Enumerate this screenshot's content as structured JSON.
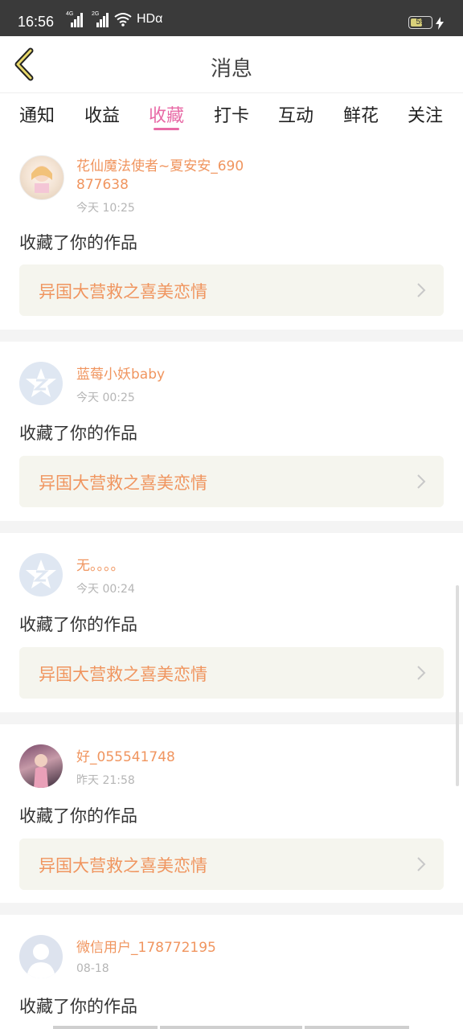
{
  "status": {
    "time": "16:56",
    "sig1": "4G",
    "sig2": "2G",
    "hd": "HDα",
    "battery": "59",
    "battery_level": 0.59
  },
  "header": {
    "title": "消息"
  },
  "tabs": [
    {
      "label": "通知"
    },
    {
      "label": "收益"
    },
    {
      "label": "收藏"
    },
    {
      "label": "打卡"
    },
    {
      "label": "互动"
    },
    {
      "label": "鲜花"
    },
    {
      "label": "关注"
    }
  ],
  "active_tab": "收藏",
  "colors": {
    "accent": "#e86aa6",
    "name": "#f0955f",
    "work_bg": "#f5f5ee"
  },
  "items": [
    {
      "user": "花仙魔法使者~夏安安_690877638",
      "time": "今天 10:25",
      "action": "收藏了你的作品",
      "work": "异国大营救之喜美恋情",
      "avatar": "photo-anime"
    },
    {
      "user": "蓝莓小妖baby",
      "time": "今天 00:25",
      "action": "收藏了你的作品",
      "work": "异国大营救之喜美恋情",
      "avatar": "default-star"
    },
    {
      "user": "无。。。。",
      "time": "今天 00:24",
      "action": "收藏了你的作品",
      "work": "异国大营救之喜美恋情",
      "avatar": "default-star"
    },
    {
      "user": "好_055541748",
      "time": "昨天 21:58",
      "action": "收藏了你的作品",
      "work": "异国大营救之喜美恋情",
      "avatar": "photo-person"
    },
    {
      "user": "微信用户_178772195",
      "time": "08-18",
      "action": "收藏了你的作品",
      "avatar": "default-person"
    }
  ]
}
